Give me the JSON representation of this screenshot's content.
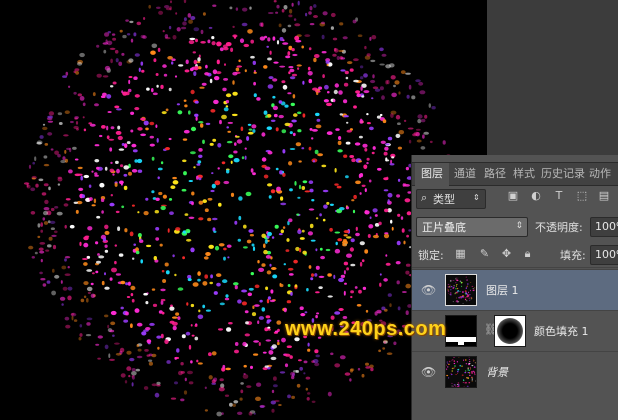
{
  "layers_panel": {
    "tabs": [
      "图层",
      "通道",
      "路径",
      "样式",
      "历史记录",
      "动作"
    ],
    "filter": {
      "kind_label": "类型",
      "icons": [
        "image-filter-icon",
        "adjustment-filter-icon",
        "text-filter-icon",
        "shape-filter-icon",
        "smart-object-filter-icon"
      ]
    },
    "blend_mode": "正片叠底",
    "opacity_label": "不透明度:",
    "opacity_value": "100%",
    "lock_label": "锁定:",
    "lock_icons": [
      "lock-transparent-icon",
      "lock-paint-icon",
      "lock-move-icon",
      "lock-all-icon"
    ],
    "fill_label": "填充:",
    "fill_value": "100%",
    "layers": [
      {
        "name": "图层 1",
        "visible": true,
        "selected": true
      },
      {
        "name": "颜色填充 1",
        "visible": false,
        "selected": false
      },
      {
        "name": "背景",
        "visible": true,
        "selected": false
      }
    ]
  },
  "watermark": "www.240ps.com",
  "colors": {
    "canvas_bg": "#000000",
    "panel_bg": "#535353",
    "selected_layer": "#5d6b80",
    "watermark": "#ffd21a",
    "particles": [
      "#ff2bd6",
      "#ff1f8f",
      "#9b3cff",
      "#ffe61a",
      "#39ff5a",
      "#1adcff",
      "#ff8a1a",
      "#ff2a2a",
      "#ffffff"
    ]
  }
}
